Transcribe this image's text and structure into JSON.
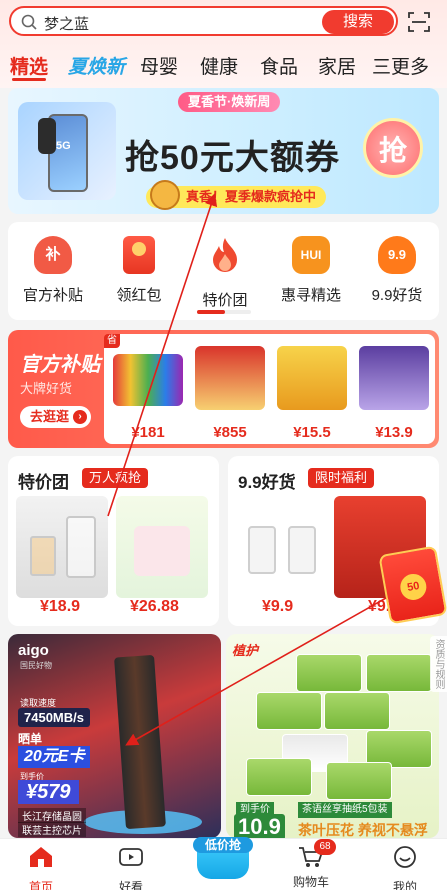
{
  "search": {
    "query": "梦之蓝",
    "button": "搜索"
  },
  "tabs": [
    "精选",
    "夏焕新",
    "母婴",
    "健康",
    "食品",
    "家居"
  ],
  "more_label": "三更多",
  "banner": {
    "tag": "夏香节·焕新周",
    "headline": "抢50元大额券",
    "grab": "抢",
    "sub": "真香！夏季爆款疯抢中",
    "phone_mark": "5G"
  },
  "categories": [
    {
      "label": "官方补贴",
      "icon": "subsidy-bag-icon",
      "glyph": "补"
    },
    {
      "label": "领红包",
      "icon": "red-envelope-icon",
      "glyph": ""
    },
    {
      "label": "特价团",
      "icon": "flame-icon",
      "glyph": ""
    },
    {
      "label": "惠寻精选",
      "icon": "hui-icon",
      "glyph": "HUI"
    },
    {
      "label": "9.9好货",
      "icon": "price-99-icon",
      "glyph": "9.9"
    }
  ],
  "subsidy": {
    "title": "官方补贴",
    "desc": "大牌好货",
    "cta": "去逛逛",
    "badge": "省",
    "prices": [
      "¥181",
      "¥855",
      "¥15.5",
      "¥13.9"
    ]
  },
  "group_deals": {
    "title": "特价团",
    "pill": "万人疯抢",
    "prices": [
      "¥18.9",
      "¥26.88"
    ]
  },
  "cheap_goods": {
    "title": "9.9好货",
    "pill": "限时福利",
    "prices": [
      "¥9.9",
      "¥9.9"
    ]
  },
  "red_packet_label": "50",
  "ssd_tile": {
    "brand": "aigo",
    "brand_sub": "国民好物",
    "speed_label": "读取速度",
    "speed": "7450MB/s",
    "single": "晒单",
    "ecard": "20元E卡",
    "promo_label": "到手价",
    "price": "¥579",
    "feature1": "长江存储晶圆",
    "feature2": "联芸主控芯片"
  },
  "tissue_tile": {
    "logo": "植护",
    "deal_label": "到手价",
    "deal_price": "10.9",
    "name": "茶语丝享抽纸5包装",
    "slogan": "茶叶压花 养视不悬浮"
  },
  "side_note": "资质与规则",
  "nav": [
    {
      "label": "首页",
      "icon": "home-icon"
    },
    {
      "label": "好看",
      "icon": "video-icon"
    },
    {
      "label": "低价抢",
      "icon": "bag-icon"
    },
    {
      "label": "购物车",
      "icon": "cart-icon"
    },
    {
      "label": "我的",
      "icon": "profile-icon"
    }
  ],
  "cart_count": "68",
  "colors": {
    "accent": "#e52b1d",
    "brand_blue": "#28a6e6"
  }
}
